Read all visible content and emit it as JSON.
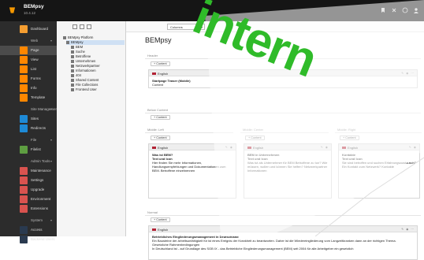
{
  "topbar": {
    "brand": "BEMpsy",
    "version": "10.4.12"
  },
  "sidebar": {
    "modules": [
      {
        "label": "Dashboard",
        "color": "#f59e31",
        "head": false
      },
      {
        "label": "Web",
        "color": "",
        "head": true
      },
      {
        "label": "Page",
        "color": "#ff8700",
        "head": false,
        "active": true
      },
      {
        "label": "View",
        "color": "#ff8700",
        "head": false
      },
      {
        "label": "List",
        "color": "#ff8700",
        "head": false
      },
      {
        "label": "Forms",
        "color": "#ff8700",
        "head": false
      },
      {
        "label": "Info",
        "color": "#ff8700",
        "head": false
      },
      {
        "label": "Template",
        "color": "#ff8700",
        "head": false
      },
      {
        "label": "Site Management",
        "color": "",
        "head": true
      },
      {
        "label": "Sites",
        "color": "#1e8ad6",
        "head": false
      },
      {
        "label": "Redirects",
        "color": "#1e8ad6",
        "head": false
      },
      {
        "label": "File",
        "color": "",
        "head": true
      },
      {
        "label": "Filelist",
        "color": "#5e9e41",
        "head": false
      },
      {
        "label": "Admin Tools",
        "color": "",
        "head": true
      },
      {
        "label": "Maintenance",
        "color": "#d9534f",
        "head": false
      },
      {
        "label": "Settings",
        "color": "#d9534f",
        "head": false
      },
      {
        "label": "Upgrade",
        "color": "#d9534f",
        "head": false
      },
      {
        "label": "Environment",
        "color": "#d9534f",
        "head": false
      },
      {
        "label": "Extensions",
        "color": "#d9534f",
        "head": false
      },
      {
        "label": "System",
        "color": "",
        "head": true
      },
      {
        "label": "Access",
        "color": "#2a3a4f",
        "head": false
      },
      {
        "label": "Backend Users",
        "color": "#2a3a4f",
        "head": false
      }
    ]
  },
  "tree": {
    "items": [
      {
        "label": "BEMpsy Platform",
        "sel": false
      },
      {
        "label": "BEMpsy",
        "sel": true
      },
      {
        "label": "BEM",
        "sel": false
      },
      {
        "label": "Suche",
        "sel": false
      },
      {
        "label": "Betroffene",
        "sel": false
      },
      {
        "label": "Unternehmen",
        "sel": false
      },
      {
        "label": "Netzwerkpartner",
        "sel": false
      },
      {
        "label": "Informationen",
        "sel": false
      },
      {
        "label": "404",
        "sel": false
      },
      {
        "label": "Shared Content",
        "sel": false
      },
      {
        "label": "File Collections",
        "sel": false
      },
      {
        "label": "Frontend User",
        "sel": false
      }
    ]
  },
  "docbar": {
    "select": "Columns"
  },
  "page": {
    "title": "BEMpsy",
    "sections": {
      "header": "Header",
      "below": "Below Content",
      "left": "Middle: Left",
      "center": "Middle: Center",
      "right": "Middle: Right",
      "normal": "Normal"
    },
    "content_btn": "+ Content",
    "lang": "English",
    "cards": {
      "header": {
        "title": "Startpage Teaser (Mobile)",
        "body": "Content"
      },
      "left": {
        "title": "Was ist BEM?",
        "sub": "Text und Icon",
        "body": "Hier finden Sie mehr Informationen, Handlungsempfehlungen und Dokumentationen zum BEM. Betroffene einzelnennen"
      },
      "center": {
        "title": "BEM in Unternehmen",
        "sub": "Text und Icon",
        "body": "Was tut als Unternehmer für BEM Betroffene zu tun? Wie müssen, wollen und können Sie helfen? Netzwerkpartner Informationen"
      },
      "right": {
        "title": "Kontakte",
        "sub": "Text und Icon",
        "body": "Sie sind betroffen und suchen Erfahrungsaustausch? Ein Kontakt zum Netzwerk? Kontakte"
      },
      "normal": {
        "title": "Betriebliches Eingliederungsmanagement in Deutschland",
        "body1": "Ein Bausteine der Arbeitsunfähigkeit für ist eines Ereignis der Krankheit zu beantworten. Daher ist die Wiedereingliederung vom Langzeitkranken dann an der richtigen Thema.",
        "body2": "Gesetzliche Rahmenbedingungen",
        "body3": "In Deutschland ist - auf Grundlage des SGB IX - das Betriebliche Eingliederungsmanagement (BEM) seit 2004 für alle Arbeitgeber ein gesetzlich"
      }
    }
  },
  "stamp": {
    "text": "intern",
    "color": "#2fbb29"
  }
}
